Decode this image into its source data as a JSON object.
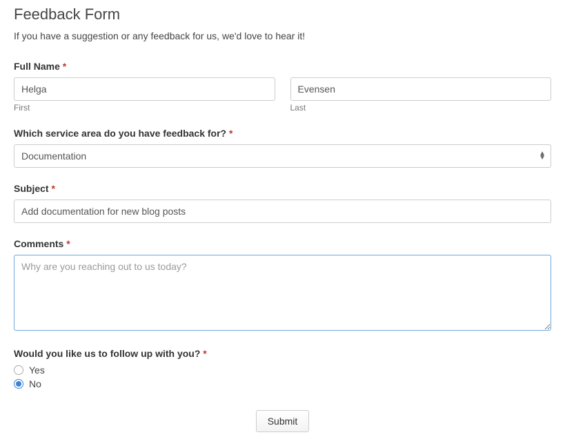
{
  "title": "Feedback Form",
  "description": "If you have a suggestion or any feedback for us, we'd love to hear it!",
  "fields": {
    "full_name": {
      "label": "Full Name",
      "first_label": "First",
      "first_value": "Helga",
      "last_label": "Last",
      "last_value": "Evensen"
    },
    "service_area": {
      "label": "Which service area do you have feedback for?",
      "value": "Documentation"
    },
    "subject": {
      "label": "Subject",
      "value": "Add documentation for new blog posts"
    },
    "comments": {
      "label": "Comments",
      "placeholder": "Why are you reaching out to us today?",
      "value": ""
    },
    "followup": {
      "label": "Would you like us to follow up with you?",
      "options": {
        "yes": "Yes",
        "no": "No"
      },
      "selected": "no"
    }
  },
  "asterisk": "*",
  "submit_label": "Submit"
}
